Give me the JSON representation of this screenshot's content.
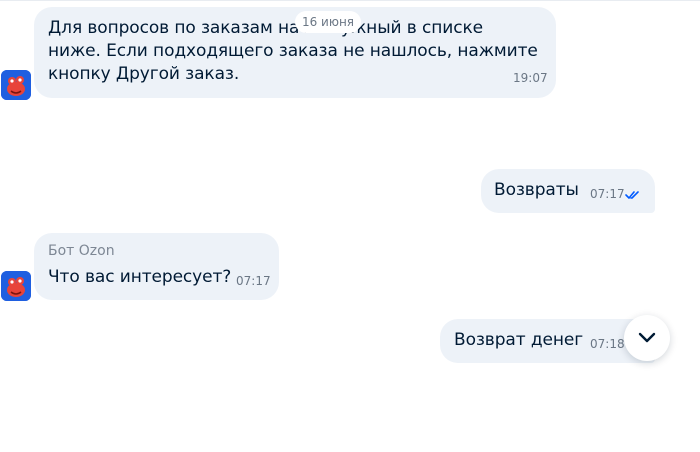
{
  "date_separator": "16 июня",
  "messages": [
    {
      "direction": "incoming",
      "text_line1": "Для вопросов по заказам на",
      "text_line1b": "на нужный в списке",
      "text_line2": "ниже. Если подходящего заказа не нашлось, нажмите",
      "text_line3": "кнопку Другой заказ.",
      "time": "19:07"
    },
    {
      "direction": "outgoing",
      "text": "Возвраты",
      "time": "07:17",
      "status": "read"
    },
    {
      "direction": "incoming",
      "sender": "Бот Ozon",
      "text": "Что вас интересует?",
      "time": "07:17"
    },
    {
      "direction": "outgoing",
      "text": "Возврат денег",
      "time": "07:18"
    }
  ],
  "icons": {
    "avatar": "ozon-bot-avatar",
    "read_status": "double-check-icon",
    "scroll_down": "chevron-down-icon"
  },
  "colors": {
    "bubble": "#edf2f8",
    "text": "#001a34",
    "meta": "#6b7785",
    "check": "#005bff"
  }
}
